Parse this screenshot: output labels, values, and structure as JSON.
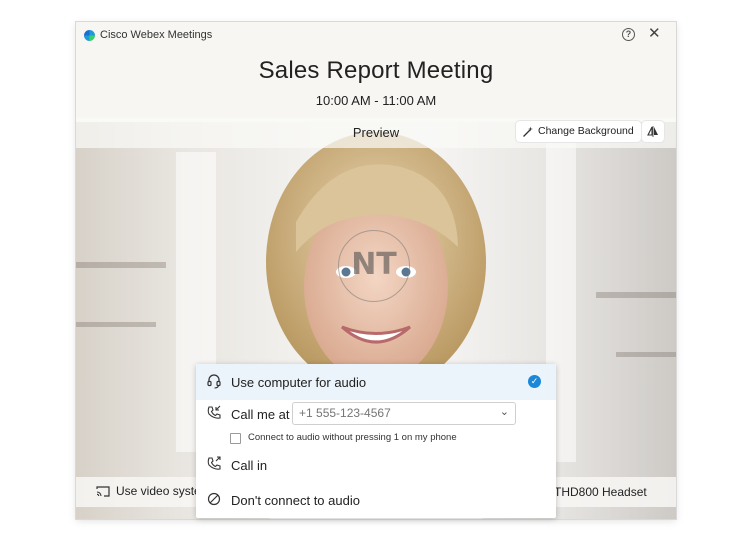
{
  "window": {
    "app_title": "Cisco Webex Meetings",
    "help_glyph": "?",
    "close_glyph": "✕"
  },
  "meeting": {
    "title": "Sales Report Meeting",
    "time": "10:00 AM - 11:00 AM"
  },
  "preview": {
    "label": "Preview",
    "change_background_label": "Change Background"
  },
  "watermark": {
    "text": "NT"
  },
  "bottom_bar": {
    "video_system_label": "Use video syste",
    "headset_label": "THD800 Headset"
  },
  "audio_menu": {
    "options": [
      {
        "label": "Use computer for audio",
        "icon": "headset-icon",
        "selected": true
      },
      {
        "label": "Call me at",
        "icon": "phone-incoming-icon"
      },
      {
        "label": "Call in",
        "icon": "phone-outgoing-icon"
      },
      {
        "label": "Don't connect to audio",
        "icon": "no-audio-icon"
      }
    ],
    "phone_placeholder": "+1 555-123-4567",
    "checkbox_label": "Connect to audio without pressing 1 on my phone",
    "checkbox_checked": false,
    "accent_color": "#1b87d9",
    "selected_bg": "#ebf3fb"
  }
}
